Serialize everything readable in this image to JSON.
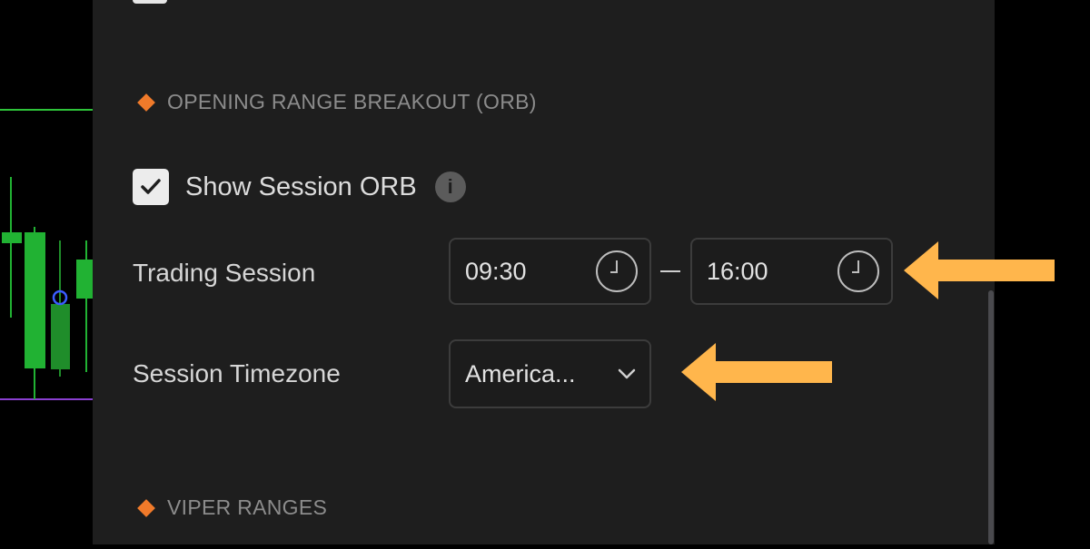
{
  "sections": {
    "orb_header": "OPENING RANGE BREAKOUT (ORB)",
    "viper_header": "VIPER RANGES"
  },
  "orb": {
    "show_session_label": "Show Session ORB",
    "show_session_checked": true,
    "trading_session_label": "Trading Session",
    "session_start": "09:30",
    "session_end": "16:00",
    "timezone_label": "Session Timezone",
    "timezone_value": "America..."
  },
  "colors": {
    "accent_diamond": "#f07a2a",
    "annotation_arrow": "#ffb64c",
    "candle_green": "#21b233"
  },
  "icons": [
    "check-icon",
    "info-icon",
    "clock-icon",
    "chevron-down-icon",
    "diamond-icon",
    "arrow-left-icon"
  ]
}
